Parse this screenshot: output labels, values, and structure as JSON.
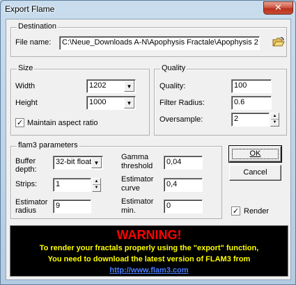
{
  "window": {
    "title": "Export Flame",
    "close_glyph": "✕"
  },
  "destination": {
    "legend": "Destination",
    "file_label": "File name:",
    "file_value": "C:\\Neue_Downloads A-N\\Apophysis Fractale\\Apophysis 2",
    "browse_icon": "open-folder-icon"
  },
  "size": {
    "legend": "Size",
    "width_label": "Width",
    "width_value": "1202",
    "height_label": "Height",
    "height_value": "1000",
    "aspect_label": "Maintain aspect ratio",
    "aspect_checked": true
  },
  "quality": {
    "legend": "Quality",
    "quality_label": "Quality:",
    "quality_value": "100",
    "filter_label": "Filter Radius:",
    "filter_value": "0.6",
    "oversample_label": "Oversample:",
    "oversample_value": "2"
  },
  "flam3": {
    "legend": "flam3 parameters",
    "buffer_label_1": "Buffer",
    "buffer_label_2": "depth:",
    "buffer_value": "32-bit float",
    "strips_label": "Strips:",
    "strips_value": "1",
    "est_radius_label_1": "Estimator",
    "est_radius_label_2": "radius",
    "est_radius_value": "9",
    "gamma_label_1": "Gamma",
    "gamma_label_2": "threshold",
    "gamma_value": "0,04",
    "est_curve_label_1": "Estimator",
    "est_curve_label_2": "curve",
    "est_curve_value": "0,4",
    "est_min_label_1": "Estimator",
    "est_min_label_2": "min.",
    "est_min_value": "0"
  },
  "buttons": {
    "ok": "OK",
    "cancel": "Cancel"
  },
  "render": {
    "label": "Render",
    "checked": true
  },
  "warning": {
    "title": "WARNING!",
    "line1": "To render your fractals properly using the \"export\" function,",
    "line2": "You need to download the latest version of FLAM3 from",
    "link": "http://www.flam3.com",
    "colors": {
      "background": "#000000",
      "title": "#ff0000",
      "text": "#ffff00",
      "link": "#4a7dff"
    }
  }
}
